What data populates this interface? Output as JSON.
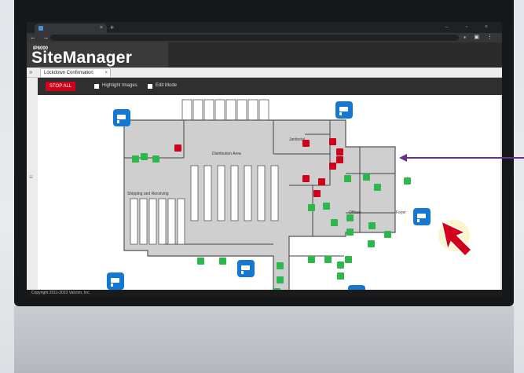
{
  "app": {
    "brand_prefix": "IP6000",
    "brand_name": "SiteManager"
  },
  "browser": {
    "tab_close": "×",
    "new_tab": "+",
    "nav": "← → C",
    "window_controls": "– ▫ ×",
    "toolbar_icons": "⁎ ▣ ⋮"
  },
  "tabs": {
    "collapse_label": "»",
    "items": [
      {
        "label": "Lockdown Confirmation",
        "close": "×"
      }
    ]
  },
  "controls": {
    "stop_all_label": "STOP ALL",
    "highlight_images_label": "Highlight Images",
    "edit_mode_label": "Edit Mode",
    "stop_color": "#d0021b"
  },
  "sidebar": {
    "menu_glyph": "≡"
  },
  "floorplan": {
    "rooms": {
      "janitorial": "Janitorial",
      "distribution": "Distribution Area",
      "shipping": "Shipping and Receiving",
      "offices": "Offices",
      "foyer": "Foyer"
    },
    "status_colors": {
      "ok": "#2db84b",
      "alert": "#d0021b"
    }
  },
  "footer": {
    "copyright": "Copyright 2011-2023 Valcom, Inc."
  }
}
